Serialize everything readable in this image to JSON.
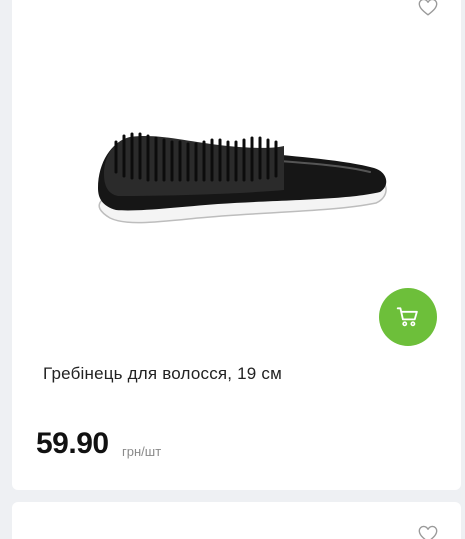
{
  "product": {
    "title": "Гребінець для волосся, 19 см",
    "price": "59.90",
    "unit": "грн/шт",
    "image_icon": "hair-brush-image"
  },
  "actions": {
    "favorite_icon": "heart-outline-icon",
    "cart_icon": "shopping-cart-icon"
  },
  "colors": {
    "accent": "#6dbf3a",
    "page_background": "#eef0f3",
    "card_background": "#ffffff",
    "price_text": "#111111",
    "unit_text": "#8a8a8a"
  }
}
